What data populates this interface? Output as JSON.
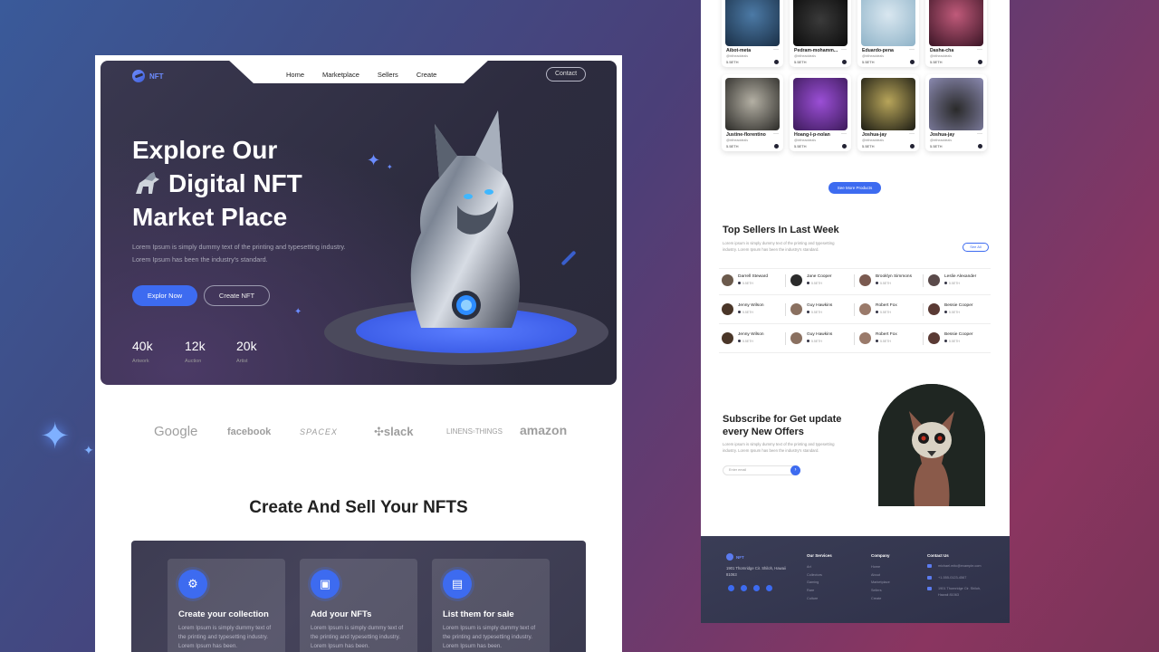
{
  "colors": {
    "accent": "#3d6bf0",
    "hero_bg": "#2d2c3f",
    "page_bg_start": "#3a5a9a",
    "page_bg_end": "#8a3560"
  },
  "hero": {
    "logo": "NFT",
    "nav": [
      "Home",
      "Marketplace",
      "Sellers",
      "Create"
    ],
    "contact": "Contact",
    "title_line1": "Explore Our",
    "title_line2": "Digital NFT",
    "title_line3": "Market Place",
    "subtitle": "Lorem Ipsum is simply dummy text of the printing and typesetting industry. Lorem Ipsum has been the industry's standard.",
    "explore_button": "Explor Now",
    "create_button": "Create NFT",
    "stats": [
      {
        "value": "40k",
        "label": "Artwork"
      },
      {
        "value": "12k",
        "label": "Auction"
      },
      {
        "value": "20k",
        "label": "Artist"
      }
    ]
  },
  "brands": [
    "Google",
    "facebook",
    "SPACEX",
    "slack",
    "LINENS▫THINGS",
    "amazon"
  ],
  "create_section": {
    "title": "Create And Sell Your NFTS",
    "cards": [
      {
        "title": "Create your collection",
        "text": "Lorem Ipsum is simply dummy text of the printing and typesetting industry. Lorem Ipsum has been.",
        "icon": "collection-icon"
      },
      {
        "title": "Add your NFTs",
        "text": "Lorem Ipsum is simply dummy text of the printing and typesetting industry. Lorem Ipsum has been.",
        "icon": "image-add-icon"
      },
      {
        "title": "List them for sale",
        "text": "Lorem Ipsum is simply dummy text of the printing and typesetting industry. Lorem Ipsum has been.",
        "icon": "clipboard-list-icon"
      }
    ]
  },
  "nft_grid": [
    {
      "name": "Aibot-meta",
      "handle": "@bitheaddeals",
      "price": "5.5ETH"
    },
    {
      "name": "Pedram-mohamm...",
      "handle": "@bitheaddeals",
      "price": "5.5ETH"
    },
    {
      "name": "Eduardo-pena",
      "handle": "@bitheaddeals",
      "price": "5.5ETH"
    },
    {
      "name": "Dasha-cha",
      "handle": "@bitheaddeals",
      "price": "5.5ETH"
    },
    {
      "name": "Justine-florentino",
      "handle": "@bitheaddeals",
      "price": "5.5ETH"
    },
    {
      "name": "Hoang-l-p-nolan",
      "handle": "@bitheaddeals",
      "price": "5.5ETH"
    },
    {
      "name": "Joshua-jay",
      "handle": "@bitheaddeals",
      "price": "5.5ETH"
    },
    {
      "name": "Joshua-jay",
      "handle": "@bitheaddeals",
      "price": "5.5ETH"
    }
  ],
  "see_more": "See More Products",
  "top_sellers": {
    "title": "Top Sellers In Last Week",
    "subtitle": "Lorem ipsum is simply dummy text of the printing and typesetting industry. Lorem Ipsum has been the industry's standard.",
    "see_all": "See All",
    "sellers": [
      {
        "name": "Darrell Steward",
        "eth": "5.5ETH"
      },
      {
        "name": "Jane Cooper",
        "eth": "5.5ETH"
      },
      {
        "name": "Brooklyn Simmons",
        "eth": "5.5ETH"
      },
      {
        "name": "Leslie Alexander",
        "eth": "5.5ETH"
      },
      {
        "name": "Jenny Wilson",
        "eth": "5.5ETH"
      },
      {
        "name": "Guy Hawkins",
        "eth": "5.5ETH"
      },
      {
        "name": "Robert Fox",
        "eth": "5.5ETH"
      },
      {
        "name": "Bessie Cooper",
        "eth": "5.5ETH"
      },
      {
        "name": "Jenny Wilson",
        "eth": "5.5ETH"
      },
      {
        "name": "Guy Hawkins",
        "eth": "5.5ETH"
      },
      {
        "name": "Robert Fox",
        "eth": "5.5ETH"
      },
      {
        "name": "Bessie Cooper",
        "eth": "5.5ETH"
      }
    ]
  },
  "subscribe": {
    "title": "Subscribe for Get update every New Offers",
    "subtitle": "Lorem ipsum is simply dummy text of the printing and typesetting industry. Lorem Ipsum has been the industry's standard.",
    "placeholder": "Enter email"
  },
  "footer": {
    "logo": "NFT",
    "address": "1901 Thornridge Cir. Shiloh, Hawaii 81063",
    "columns": [
      {
        "title": "Our Services",
        "items": [
          "Art",
          "Collectors",
          "Gaming",
          "Rare",
          "Culture"
        ]
      },
      {
        "title": "Company",
        "items": [
          "Home",
          "About",
          "Marketplace",
          "Sellers",
          "Create"
        ]
      }
    ],
    "contact_title": "Contact Us",
    "contact_items": [
      "michael.mitc@example.com",
      "+1-555-0123-4567",
      "1901 Thornridge Cir. Shiloh, Hawaii 81063"
    ]
  }
}
